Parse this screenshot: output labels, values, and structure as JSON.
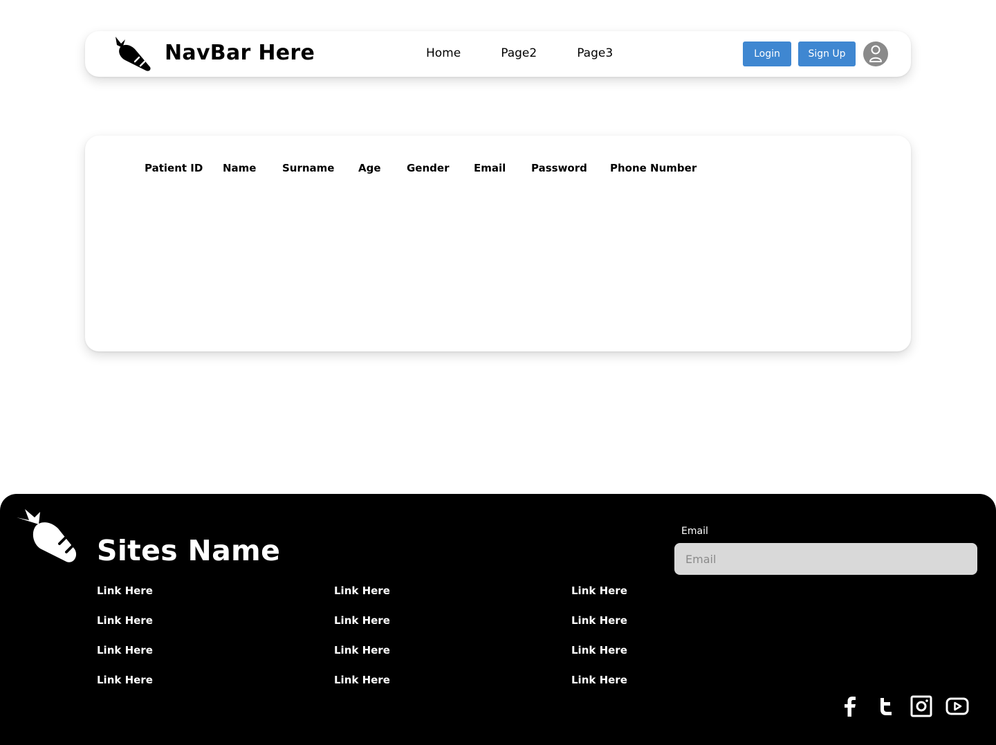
{
  "navbar": {
    "logo_icon": "carrot-icon",
    "title": "NavBar Here",
    "links": [
      "Home",
      "Page2",
      "Page3"
    ],
    "login_label": "Login",
    "signup_label": "Sign Up",
    "avatar_icon": "user-icon",
    "accent_color": "#3f87d1"
  },
  "table": {
    "columns": [
      "Patient ID",
      "Name",
      "Surname",
      "Age",
      "Gender",
      "Email",
      "Password",
      "Phone Number"
    ],
    "rows": []
  },
  "footer": {
    "logo_icon": "carrot-icon",
    "site_name": "Sites Name",
    "link_columns": [
      [
        "Link Here",
        "Link Here",
        "Link Here",
        "Link Here"
      ],
      [
        "Link Here",
        "Link Here",
        "Link Here",
        "Link Here"
      ],
      [
        "Link Here",
        "Link Here",
        "Link Here",
        "Link Here"
      ]
    ],
    "email_label": "Email",
    "email_placeholder": "Email",
    "email_value": "",
    "social_icons": [
      "facebook-icon",
      "twitter-icon",
      "instagram-icon",
      "youtube-icon"
    ]
  }
}
